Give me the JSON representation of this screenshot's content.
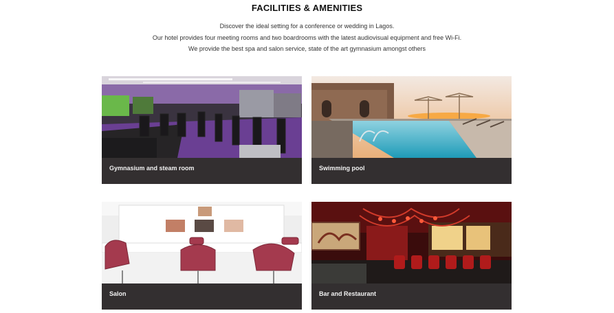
{
  "section": {
    "title": "FACILITIES & AMENITIES",
    "intro_lines": [
      "Discover the ideal setting for a conference or wedding in Lagos.",
      "Our hotel provides four meeting rooms and two boardrooms with the latest audiovisual equipment and free Wi-Fi.",
      "We provide the best spa and salon service, state of the art gymnasium amongst others"
    ]
  },
  "facilities": [
    {
      "caption": "Gymnasium and steam room",
      "image": "gym-photo"
    },
    {
      "caption": "Swimming pool",
      "image": "pool-photo"
    },
    {
      "caption": "Salon",
      "image": "salon-photo"
    },
    {
      "caption": "Bar and Restaurant",
      "image": "bar-photo"
    }
  ],
  "colors": {
    "caption_bg": "#332f30",
    "caption_text": "#f2f2f2"
  }
}
